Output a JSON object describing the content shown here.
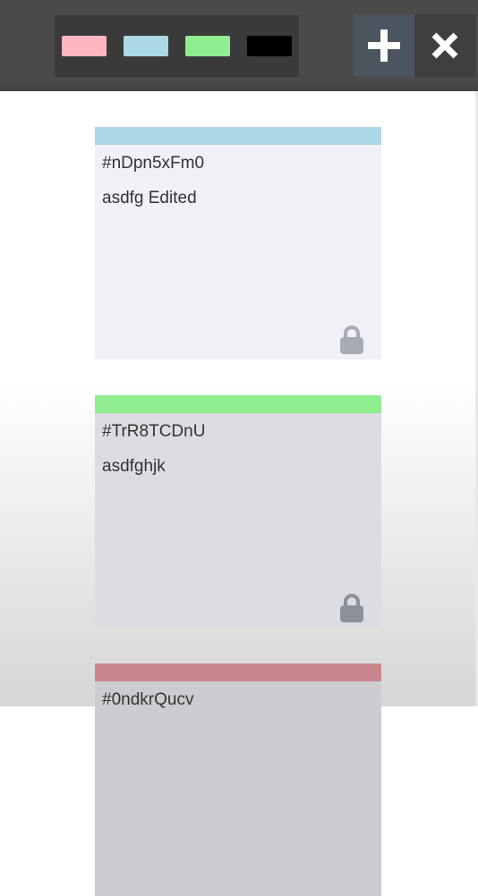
{
  "toolbar": {
    "swatches": [
      {
        "name": "pink",
        "color": "#ffb6c1"
      },
      {
        "name": "light-blue",
        "color": "#add8e6"
      },
      {
        "name": "light-green",
        "color": "#90ee90"
      },
      {
        "name": "black",
        "color": "#000000"
      }
    ],
    "add_icon": "plus-icon",
    "close_icon": "close-icon"
  },
  "notes": [
    {
      "id": "#nDpn5xFm0",
      "text": "asdfg Edited",
      "color": "#add8e6",
      "locked": true
    },
    {
      "id": "#TrR8TCDnU",
      "text": "asdfghjk",
      "color": "#90ee90",
      "locked": true
    },
    {
      "id": "#0ndkrQucv",
      "text": "",
      "color": "#c9868e",
      "locked": false
    }
  ]
}
